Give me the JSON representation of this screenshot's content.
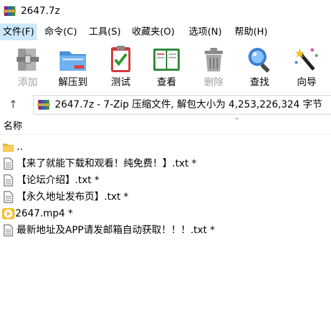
{
  "window": {
    "title": "2647.7z",
    "app_icon": "winrar-books-icon"
  },
  "menu": [
    {
      "label": "文件(F)",
      "active": true
    },
    {
      "label": "命令(C)"
    },
    {
      "label": "工具(S)"
    },
    {
      "label": "收藏夹(O)"
    },
    {
      "label": "选项(N)"
    },
    {
      "label": "帮助(H)"
    }
  ],
  "toolbar": [
    {
      "label": "添加",
      "icon": "add-archive-icon",
      "disabled": true
    },
    {
      "label": "解压到",
      "icon": "extract-folder-icon"
    },
    {
      "label": "测试",
      "icon": "test-checklist-icon"
    },
    {
      "label": "查看",
      "icon": "view-book-icon"
    },
    {
      "label": "删除",
      "icon": "trash-can-icon",
      "disabled": true
    },
    {
      "label": "查找",
      "icon": "magnifier-icon"
    },
    {
      "label": "向导",
      "icon": "wizard-wand-icon"
    }
  ],
  "address": {
    "text": "2647.7z - 7-Zip 压缩文件, 解包大小为 4,253,226,324 字节"
  },
  "list_header": {
    "name_column": "名称"
  },
  "files": [
    {
      "name": "..",
      "icon": "folder-up-icon"
    },
    {
      "name": "【来了就能下载和观看！纯免费！】.txt *",
      "icon": "text-file-icon"
    },
    {
      "name": "【论坛介绍】.txt *",
      "icon": "text-file-icon"
    },
    {
      "name": "【永久地址发布页】.txt *",
      "icon": "text-file-icon"
    },
    {
      "name": "2647.mp4 *",
      "icon": "video-file-icon"
    },
    {
      "name": "最新地址及APP请发邮箱自动获取！！！.txt *",
      "icon": "text-file-icon"
    }
  ],
  "colors": {
    "menu_highlight": "#cce8ff",
    "disabled_text": "#a0a0a0"
  }
}
